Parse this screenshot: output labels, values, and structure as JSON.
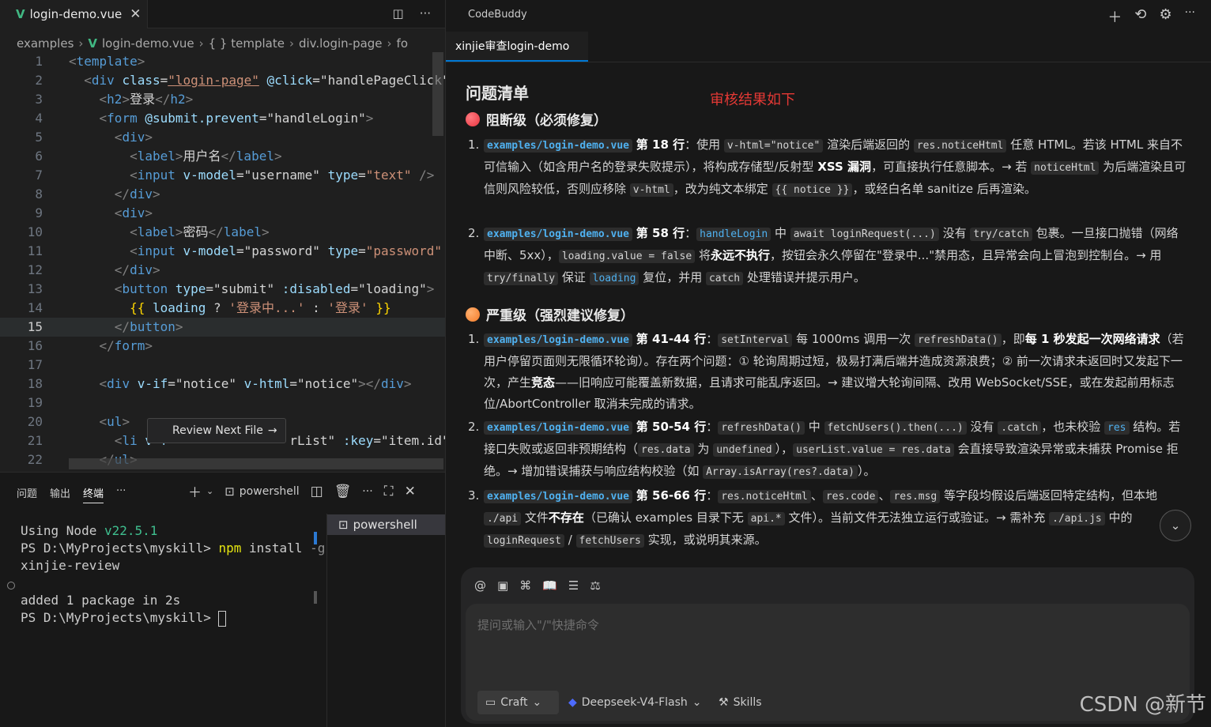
{
  "editor": {
    "tab_label": "login-demo.vue",
    "tab_icon": "vue-icon",
    "breadcrumbs": [
      "examples",
      "login-demo.vue",
      "{ } template",
      "div.login-page",
      "fo"
    ],
    "current_line": 15,
    "line_numbers": [
      "1",
      "2",
      "3",
      "4",
      "5",
      "6",
      "7",
      "8",
      "9",
      "10",
      "11",
      "12",
      "13",
      "14",
      "15",
      "16",
      "17",
      "18",
      "19",
      "20",
      "21",
      "22"
    ],
    "inline_hint": "Review Next File"
  },
  "panel": {
    "tabs": [
      "问题",
      "输出",
      "终端",
      "···"
    ],
    "shell_label": "powershell",
    "terminal_lines": {
      "l1a": "Using Node ",
      "l1b": "v22.5.1",
      "l2a": "PS D:\\MyProjects\\myskill> ",
      "l2b": "npm",
      "l2c": " install ",
      "l2d": "-g",
      "l3": "xinjie-review",
      "l4": "added 1 package in 2s",
      "l5": "PS D:\\MyProjects\\myskill> "
    },
    "terminal_list_item": "powershell"
  },
  "chat": {
    "title": "CodeBuddy",
    "tab_label": "xinjie审查login-demo",
    "heading": "问题清单",
    "annotation": "审核结果如下",
    "section1_title": "阻断级（必须修复）",
    "section2_title": "严重级（强烈建议修复）",
    "input_placeholder": "提问或输入\"/\"快捷命令",
    "mode_label": "Craft",
    "model_label": "Deepseek-V4-Flash",
    "skills_label": "Skills",
    "watermark": "CSDN @新节",
    "colors": {
      "blocker": "#e8343f",
      "severe": "#f57c28",
      "accent": "#0078d4",
      "file_link": "#4fb1f0"
    }
  }
}
